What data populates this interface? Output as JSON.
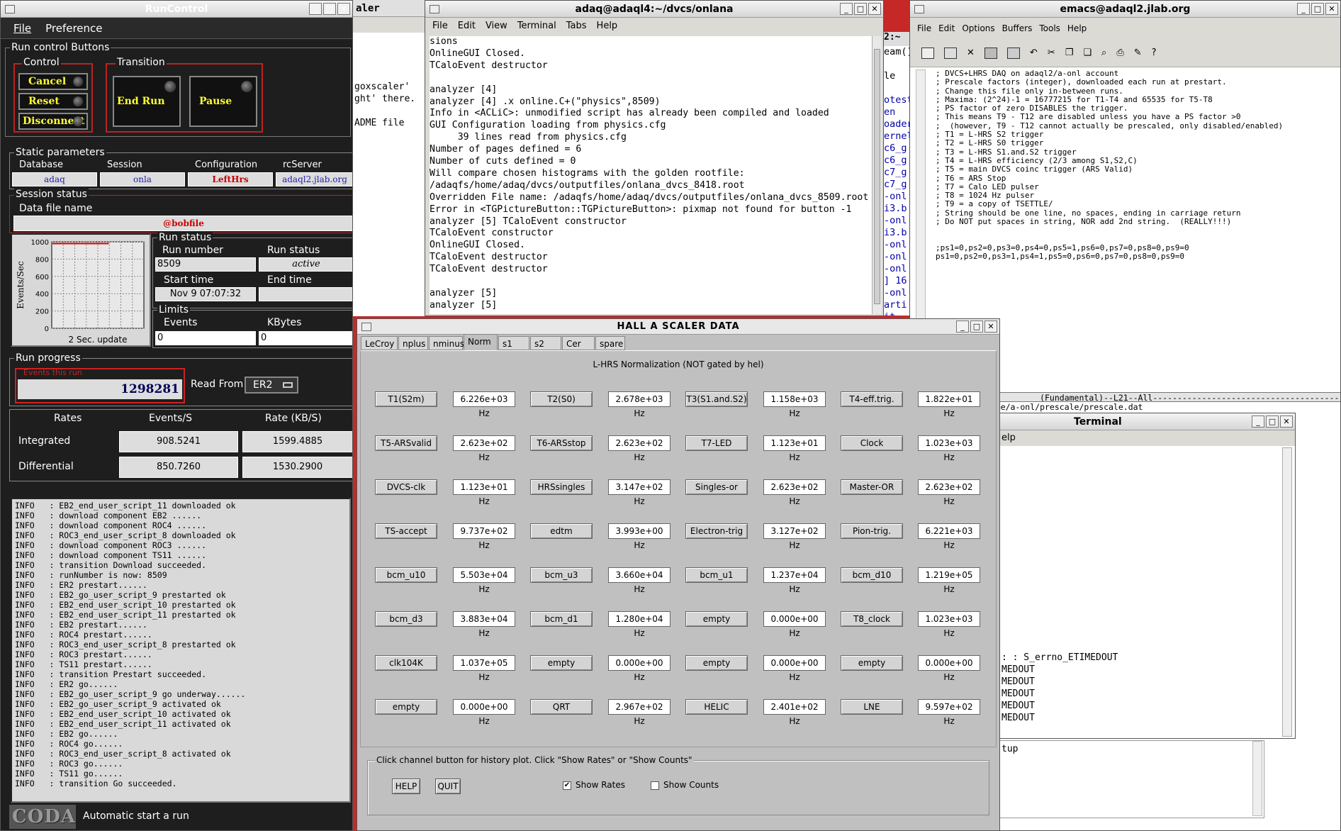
{
  "runcontrol": {
    "title": "RunControl",
    "menu": [
      "File",
      "Preference"
    ],
    "run_control_buttons_label": "Run control Buttons",
    "control_label": "Control",
    "transition_label": "Transition",
    "buttons": {
      "cancel": "Cancel",
      "reset": "Reset",
      "disconnect": "Disconnect",
      "end_run": "End Run",
      "pause": "Pause"
    },
    "static_params_label": "Static parameters",
    "static_headers": [
      "Database",
      "Session",
      "Configuration",
      "rcServer"
    ],
    "static_values": [
      "adaq",
      "onla",
      "LeftHrs",
      "adaql2.jlab.org"
    ],
    "session_status_label": "Session status",
    "data_file_label": "Data file name",
    "data_file": "@bobfile",
    "plot": {
      "ylabel": "Events/Sec",
      "yticks": [
        "1000",
        "800",
        "600",
        "400",
        "200",
        "0"
      ],
      "footer": "2 Sec. update",
      "level": 0.98
    },
    "run_status_label": "Run status",
    "run_number_label": "Run number",
    "run_number": "8509",
    "run_status_field_label": "Run status",
    "run_status": "active",
    "start_time_label": "Start time",
    "start_time": "Nov 9 07:07:32",
    "end_time_label": "End time",
    "end_time": "",
    "limits_label": "Limits",
    "events_label": "Events",
    "events_limit": "0",
    "kbytes_label": "KBytes",
    "kbytes_limit": "0",
    "run_progress_label": "Run progress",
    "events_this_run_label": "Events this run",
    "events_this_run": "1298281",
    "read_from_label": "Read From:",
    "read_from": "ER2",
    "rates_headers": [
      "Rates",
      "Events/S",
      "Rate (KB/S)"
    ],
    "integrated_label": "Integrated",
    "integrated_events": "908.5241",
    "integrated_rate": "1599.4885",
    "differential_label": "Differential",
    "differential_events": "850.7260",
    "differential_rate": "1530.2900",
    "log": [
      "INFO   : EB2_end_user_script_11 downloaded ok",
      "INFO   : download component EB2 ......",
      "INFO   : download component ROC4 ......",
      "INFO   : ROC3_end_user_script_8 downloaded ok",
      "INFO   : download component ROC3 ......",
      "INFO   : download component TS11 ......",
      "INFO   : transition Download succeeded.",
      "INFO   : runNumber is now: 8509",
      "INFO   : ER2 prestart......",
      "INFO   : EB2_go_user_script_9 prestarted ok",
      "INFO   : EB2_end_user_script_10 prestarted ok",
      "INFO   : EB2_end_user_script_11 prestarted ok",
      "INFO   : EB2 prestart......",
      "INFO   : ROC4 prestart......",
      "INFO   : ROC3_end_user_script_8 prestarted ok",
      "INFO   : ROC3 prestart......",
      "INFO   : TS11 prestart......",
      "INFO   : transition Prestart succeeded.",
      "INFO   : ER2 go......",
      "INFO   : EB2_go_user_script_9 go underway......",
      "INFO   : EB2_go_user_script_9 activated ok",
      "INFO   : EB2_end_user_script_10 activated ok",
      "INFO   : EB2_end_user_script_11 activated ok",
      "INFO   : EB2 go......",
      "INFO   : ROC4 go......",
      "INFO   : ROC3_end_user_script_8 activated ok",
      "INFO   : ROC3 go......",
      "INFO   : TS11 go......",
      "INFO   : transition Go succeeded."
    ],
    "coda_logo": "CODA",
    "status_footer": "Automatic start a run"
  },
  "scaler_partial": {
    "title": "aler",
    "lines": [
      "goxscaler'",
      "ght' there.",
      "",
      "ADME file"
    ]
  },
  "terminal": {
    "title": "adaq@adaql4:~/dvcs/onlana",
    "menu": [
      "File",
      "Edit",
      "View",
      "Terminal",
      "Tabs",
      "Help"
    ],
    "lines": [
      "sions",
      "OnlineGUI Closed.",
      "TCaloEvent destructor",
      "",
      "analyzer [4]",
      "analyzer [4] .x online.C+(\"physics\",8509)",
      "Info in <ACLiC>: unmodified script has already been compiled and loaded",
      "GUI Configuration loading from physics.cfg",
      "     39 lines read from physics.cfg",
      "Number of pages defined = 6",
      "Number of cuts defined = 0",
      "Will compare chosen histograms with the golden rootfile:",
      "/adaqfs/home/adaq/dvcs/outputfiles/onlana_dvcs_8418.root",
      "Overridden File name: /adaqfs/home/adaq/dvcs/outputfiles/onlana_dvcs_8509.root",
      "Error in <TGPictureButton::TGPictureButton>: pixmap not found for button -1",
      "analyzer [5] TCaloEvent constructor",
      "TCaloEvent constructor",
      "OnlineGUI Closed.",
      "TCaloEvent destructor",
      "TCaloEvent destructor",
      "",
      "analyzer [5]",
      "analyzer [5]"
    ]
  },
  "middle_partial": {
    "title": "2:~",
    "lines": [
      "eam()",
      "",
      "le",
      "",
      "otest",
      "en",
      "oader",
      "ernel",
      "c6_g",
      "c6_g",
      "c7_g",
      "c7_g",
      "-onl",
      "i3.b",
      "-onl",
      "i3.b",
      "-onl",
      "-onl",
      "-onl",
      "] 16",
      "-onl",
      "arti",
      "   it"
    ]
  },
  "emacs": {
    "title": "emacs@adaql2.jlab.org",
    "menu": [
      "File",
      "Edit",
      "Options",
      "Buffers",
      "Tools",
      "Help"
    ],
    "lines": [
      "; DVCS+LHRS DAQ on adaql2/a-onl account",
      "; Prescale factors (integer), downloaded each run at prestart.",
      "; Change this file only in-between runs.",
      "; Maxima: (2^24)-1 = 16777215 for T1-T4 and 65535 for T5-T8",
      "; PS factor of zero DISABLES the trigger.",
      "; This means T9 - T12 are disabled unless you have a PS factor >0",
      ";  (however, T9 - T12 cannot actually be prescaled, only disabled/enabled)",
      "; T1 = L-HRS S2 trigger",
      "; T2 = L-HRS S0 trigger",
      "; T3 = L-HRS S1.and.S2 trigger",
      "; T4 = L-HRS efficiency (2/3 among S1,S2,C)",
      "; T5 = main DVCS coinc trigger (ARS Valid)",
      "; T6 = ARS Stop",
      "; T7 = Calo LED pulser",
      "; T8 = 1024 Hz pulser",
      "; T9 = a copy of TSETTLE/",
      "; String should be one line, no spaces, ending in carriage return",
      "; Do NOT put spaces in string, NOR add 2nd string.  (REALLY!!!)",
      "",
      "",
      ";ps1=0,ps2=0,ps3=0,ps4=0,ps5=1,ps6=0,ps7=0,ps8=0,ps9=0",
      "ps1=0,ps2=0,ps3=1,ps4=1,ps5=0,ps6=0,ps7=0,ps8=0,ps9=0"
    ],
    "modeline": "at          (Fundamental)--L21--All------------------------------------------------------",
    "minibuffer": "/home/a-onl/prescale/prescale.dat"
  },
  "terminal2": {
    "title": "Terminal",
    "menu_partial": "elp",
    "lines": [
      ": : S_errno_ETIMEDOUT",
      "MEDOUT",
      "MEDOUT",
      "MEDOUT",
      "MEDOUT",
      "MEDOUT"
    ]
  },
  "emacs_bottom": {
    "text": "tup"
  },
  "scaler_window": {
    "title": "HALL  A  SCALER  DATA",
    "tabs": [
      "LeCroy",
      "nplus",
      "nminus",
      "Norm",
      "s1",
      "s2",
      "Cer",
      "spare"
    ],
    "active_tab": "Norm",
    "heading": "L-HRS Normalization (NOT gated by hel)",
    "rows": [
      [
        [
          "T1(S2m)",
          "6.226e+03 Hz"
        ],
        [
          "T2(S0)",
          "2.678e+03 Hz"
        ],
        [
          "T3(S1.and.S2)",
          "1.158e+03 Hz"
        ],
        [
          "T4-eff.trig.",
          "1.822e+01 Hz"
        ]
      ],
      [
        [
          "T5-ARSvalid",
          "2.623e+02 Hz"
        ],
        [
          "T6-ARSstop",
          "2.623e+02 Hz"
        ],
        [
          "T7-LED",
          "1.123e+01 Hz"
        ],
        [
          "Clock",
          "1.023e+03 Hz"
        ]
      ],
      [
        [
          "DVCS-clk",
          "1.123e+01 Hz"
        ],
        [
          "HRSsingles",
          "3.147e+02 Hz"
        ],
        [
          "Singles-or",
          "2.623e+02 Hz"
        ],
        [
          "Master-OR",
          "2.623e+02 Hz"
        ]
      ],
      [
        [
          "TS-accept",
          "9.737e+02 Hz"
        ],
        [
          "edtm",
          "3.993e+00 Hz"
        ],
        [
          "Electron-trig",
          "3.127e+02 Hz"
        ],
        [
          "Pion-trig.",
          "6.221e+03 Hz"
        ]
      ],
      [
        [
          "bcm_u10",
          "5.503e+04 Hz"
        ],
        [
          "bcm_u3",
          "3.660e+04 Hz"
        ],
        [
          "bcm_u1",
          "1.237e+04 Hz"
        ],
        [
          "bcm_d10",
          "1.219e+05 Hz"
        ]
      ],
      [
        [
          "bcm_d3",
          "3.883e+04 Hz"
        ],
        [
          "bcm_d1",
          "1.280e+04 Hz"
        ],
        [
          "empty",
          "0.000e+00 Hz"
        ],
        [
          "T8_clock",
          "1.023e+03 Hz"
        ]
      ],
      [
        [
          "clk104K",
          "1.037e+05 Hz"
        ],
        [
          "empty",
          "0.000e+00 Hz"
        ],
        [
          "empty",
          "0.000e+00 Hz"
        ],
        [
          "empty",
          "0.000e+00 Hz"
        ]
      ],
      [
        [
          "empty",
          "0.000e+00 Hz"
        ],
        [
          "QRT",
          "2.967e+02 Hz"
        ],
        [
          "HELIC",
          "2.401e+02 Hz"
        ],
        [
          "LNE",
          "9.597e+02 Hz"
        ]
      ]
    ],
    "footer_hint": "Click channel button for history plot.  Click \"Show Rates\" or \"Show Counts\"",
    "help": "HELP",
    "quit": "QUIT",
    "show_rates": "Show Rates",
    "show_rates_checked": true,
    "show_counts": "Show Counts",
    "show_counts_checked": false
  }
}
